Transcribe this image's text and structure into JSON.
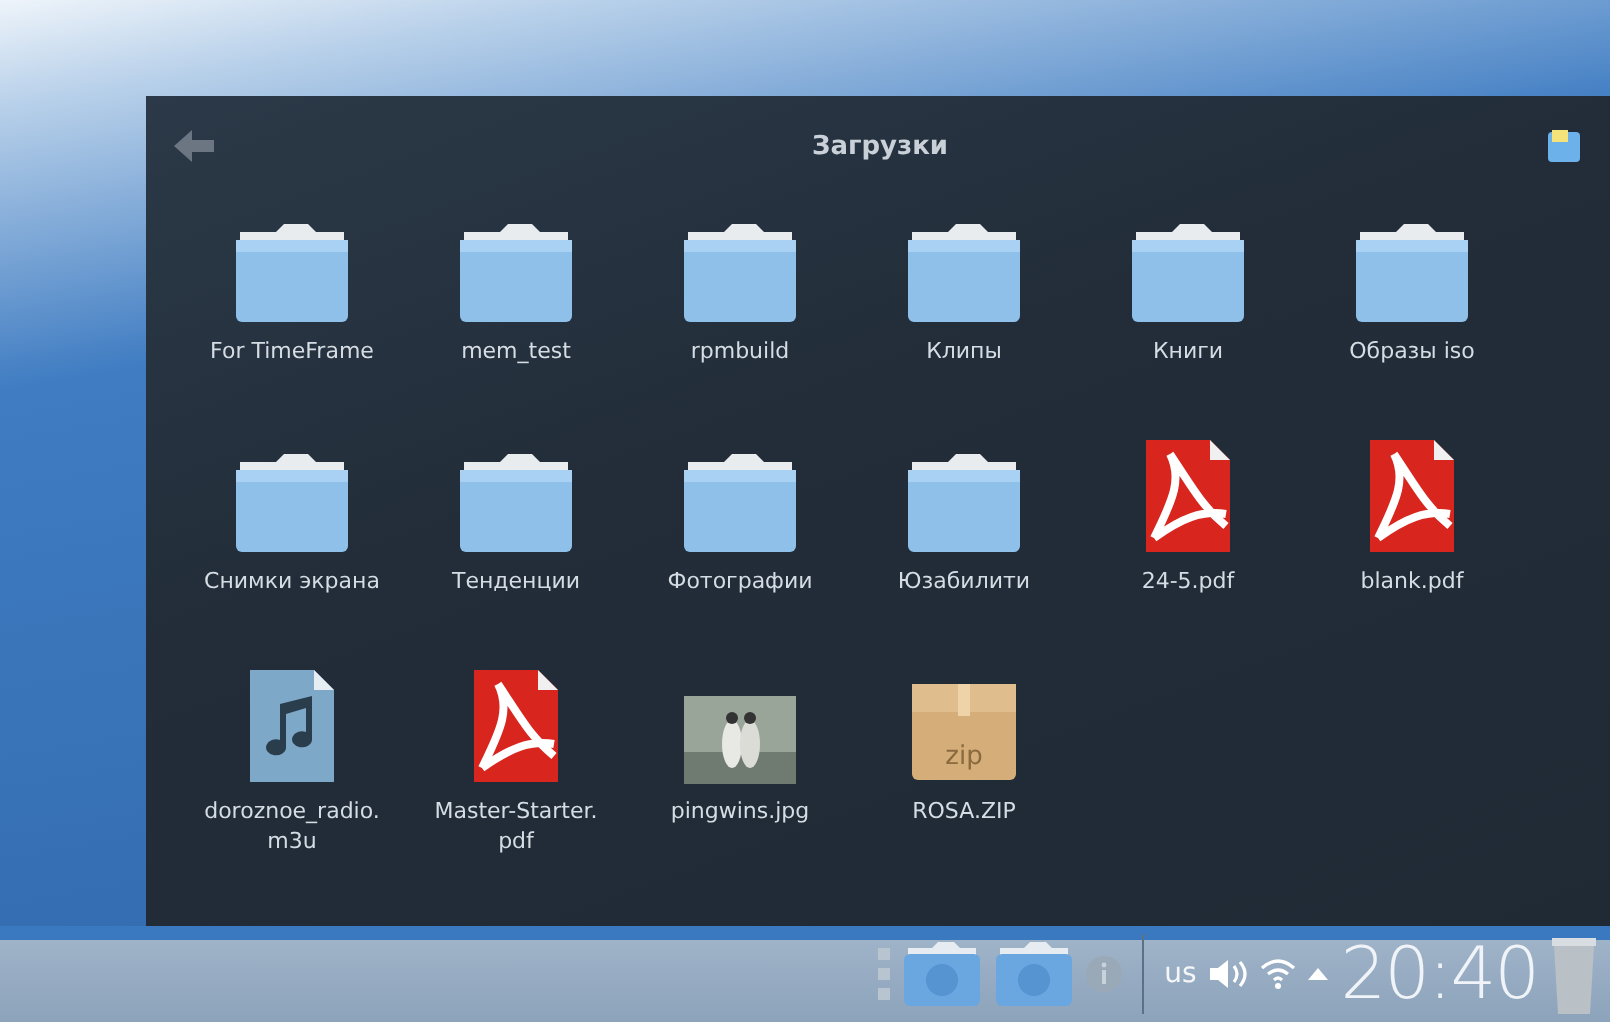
{
  "window": {
    "title": "Загрузки"
  },
  "files": [
    {
      "name": "For TimeFrame",
      "kind": "folder"
    },
    {
      "name": "mem_test",
      "kind": "folder"
    },
    {
      "name": "rpmbuild",
      "kind": "folder"
    },
    {
      "name": "Клипы",
      "kind": "folder"
    },
    {
      "name": "Книги",
      "kind": "folder"
    },
    {
      "name": "Образы iso",
      "kind": "folder"
    },
    {
      "name": "Снимки экрана",
      "kind": "folder"
    },
    {
      "name": "Тенденции",
      "kind": "folder"
    },
    {
      "name": "Фотографии",
      "kind": "folder"
    },
    {
      "name": "Юзабилити",
      "kind": "folder"
    },
    {
      "name": "24-5.pdf",
      "kind": "pdf"
    },
    {
      "name": "blank.pdf",
      "kind": "pdf"
    },
    {
      "name": "doroznoe_radio.\nm3u",
      "kind": "audio"
    },
    {
      "name": "Master-Starter.\npdf",
      "kind": "pdf"
    },
    {
      "name": "pingwins.jpg",
      "kind": "image"
    },
    {
      "name": "ROSA.ZIP",
      "kind": "archive",
      "icon_text": "zip"
    }
  ],
  "taskbar": {
    "keyboard_layout": "us",
    "clock": "20:40"
  }
}
